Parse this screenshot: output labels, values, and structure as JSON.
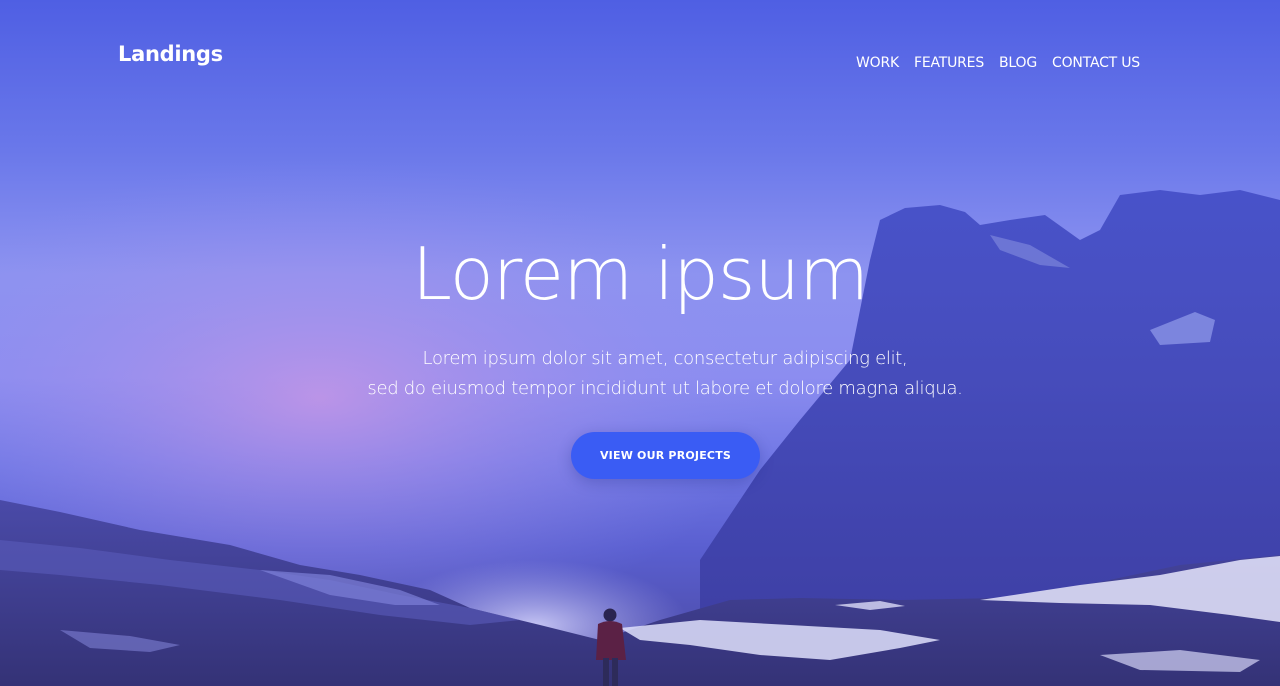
{
  "brand": {
    "name": "Landings"
  },
  "nav": {
    "items": [
      {
        "label": "WORK"
      },
      {
        "label": "FEATURES"
      },
      {
        "label": "BLOG"
      },
      {
        "label": "CONTACT US"
      }
    ]
  },
  "hero": {
    "title": "Lorem ipsum",
    "subtitle_line1": "Lorem ipsum dolor sit amet, consectetur adipiscing elit,",
    "subtitle_line2": "sed do eiusmod tempor incididunt ut labore et dolore magna aliqua.",
    "cta_label": "VIEW OUR PROJECTS"
  },
  "colors": {
    "accent": "#3a5cf4",
    "overlay": "#5e6ae6"
  }
}
